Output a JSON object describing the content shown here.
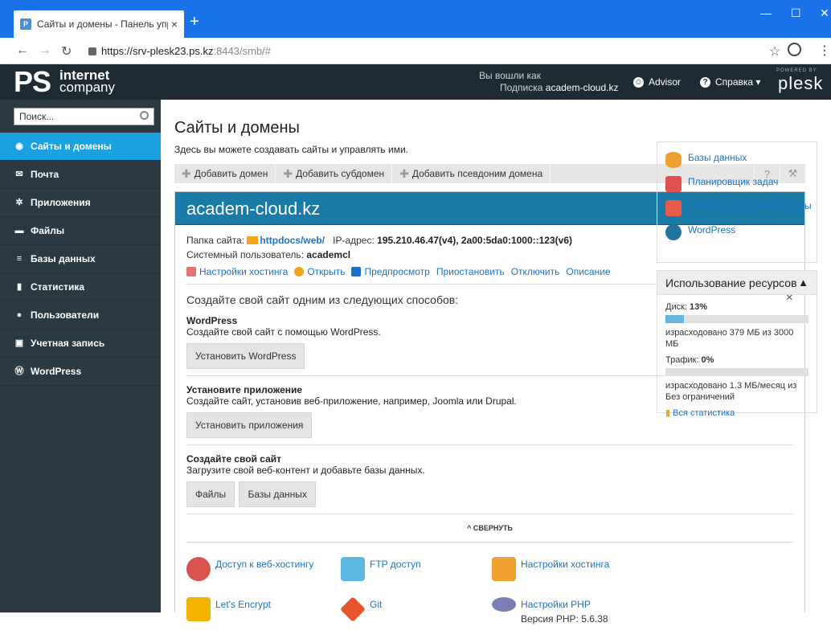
{
  "browser": {
    "tab_title": "Сайты и домены - Панель упра",
    "url_host": "https://srv-plesk23.ps.kz",
    "url_path": ":8443/smb/#"
  },
  "header": {
    "logo_ps": "PS",
    "logo_line1": "internet",
    "logo_line2": "company",
    "logged_in_label": "Вы вошли как",
    "subscription_label": "Подписка",
    "subscription_value": "academ-cloud.kz",
    "advisor": "Advisor",
    "help": "Справка",
    "powered_by": "POWERED BY",
    "plesk": "plesk"
  },
  "sidebar": {
    "search_placeholder": "Поиск...",
    "items": [
      {
        "label": "Сайты и домены",
        "icon": "globe-icon"
      },
      {
        "label": "Почта",
        "icon": "mail-icon"
      },
      {
        "label": "Приложения",
        "icon": "gear-icon"
      },
      {
        "label": "Файлы",
        "icon": "folder-icon"
      },
      {
        "label": "Базы данных",
        "icon": "database-icon"
      },
      {
        "label": "Статистика",
        "icon": "bar-chart-icon"
      },
      {
        "label": "Пользователи",
        "icon": "user-icon"
      },
      {
        "label": "Учетная запись",
        "icon": "account-icon"
      },
      {
        "label": "WordPress",
        "icon": "wordpress-icon"
      }
    ]
  },
  "main": {
    "title": "Сайты и домены",
    "description": "Здесь вы можете создавать сайты и управлять ими.",
    "toolbar": {
      "add_domain": "Добавить домен",
      "add_subdomain": "Добавить субдомен",
      "add_alias": "Добавить псевдоним домена",
      "help_glyph": "?",
      "wrench_glyph": "⚒"
    },
    "domain": {
      "name": "academ-cloud.kz",
      "folder_label": "Папка сайта:",
      "folder_value": "httpdocs/web/",
      "ip_label": "IP-адрес:",
      "ip_value": "195.210.46.47(v4), 2a00:5da0:1000::123(v6)",
      "sysuser_label": "Системный пользователь:",
      "sysuser_value": "academcl",
      "actions": [
        "Настройки хостинга",
        "Открыть",
        "Предпросмотр",
        "Приостановить",
        "Отключить",
        "Описание"
      ]
    },
    "make_site": {
      "title": "Создайте свой сайт одним из следующих способов:",
      "close": "×",
      "wp_title": "WordPress",
      "wp_desc": "Создайте свой сайт с помощью WordPress.",
      "wp_button": "Установить WordPress",
      "app_title": "Установите приложение",
      "app_desc": "Создайте сайт, установив веб-приложение, например, Joomla или Drupal.",
      "app_button": "Установить приложения",
      "own_title": "Создайте свой сайт",
      "own_desc": "Загрузите свой веб-контент и добавьте базы данных.",
      "files_button": "Файлы",
      "db_button": "Базы данных",
      "collapse": "^ СВЕРНУТЬ"
    },
    "tools": {
      "web_access": "Доступ к веб-хостингу",
      "ftp": "FTP доступ",
      "hosting_settings": "Настройки хостинга",
      "letsencrypt": "Let's Encrypt",
      "git": "Git",
      "php_settings": "Настройки PHP",
      "php_version": "Версия PHP: 5.6.38"
    }
  },
  "right": {
    "links": [
      "Базы данных",
      "Планировщик задач",
      "Контроль исходящей почты",
      "WordPress"
    ],
    "usage_title": "Использование ресурсов",
    "disk_label": "Диск:",
    "disk_value": "13%",
    "disk_used": "израсходовано 379 МБ из 3000 МБ",
    "traffic_label": "Трафик:",
    "traffic_value": "0%",
    "traffic_used": "израсходовано 1.3 МБ/месяц из Без ограничений",
    "all_stats": "Вся статистика",
    "disk_fraction": 0.13,
    "traffic_fraction": 0.0
  }
}
